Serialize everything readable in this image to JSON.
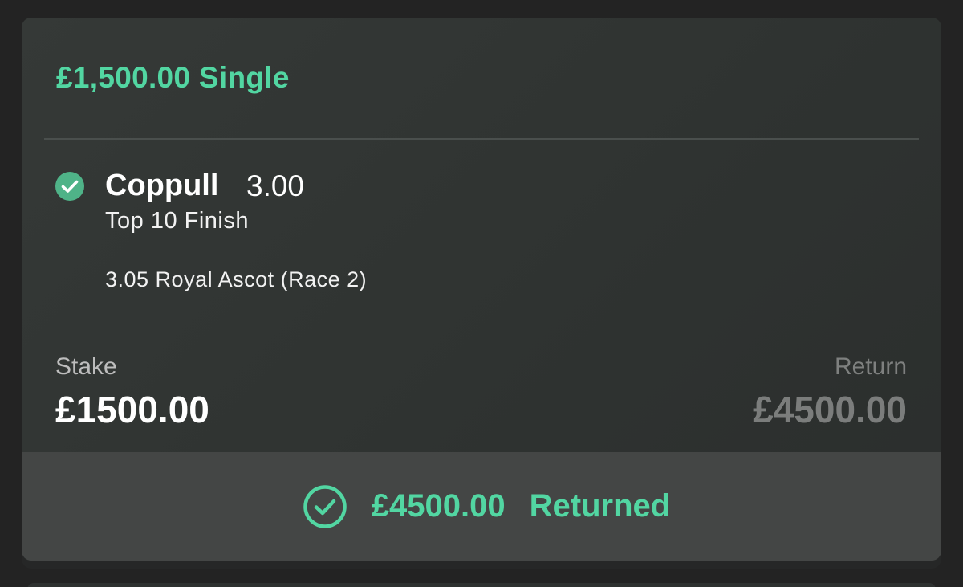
{
  "bet": {
    "title": "£1,500.00 Single"
  },
  "selection": {
    "name": "Coppull",
    "odds": "3.00",
    "market": "Top 10 Finish",
    "event": "3.05 Royal Ascot (Race 2)",
    "status_icon": "check-circle-filled-icon"
  },
  "stake": {
    "label": "Stake",
    "value": "£1500.00"
  },
  "return": {
    "label": "Return",
    "value": "£4500.00"
  },
  "result": {
    "icon": "check-circle-outline-icon",
    "amount": "£4500.00",
    "status": "Returned"
  },
  "colors": {
    "accent_green": "#52d6a2",
    "background": "#232323",
    "card": "#313533",
    "result_bar": "#444645",
    "muted_text": "#7b7d7c"
  }
}
